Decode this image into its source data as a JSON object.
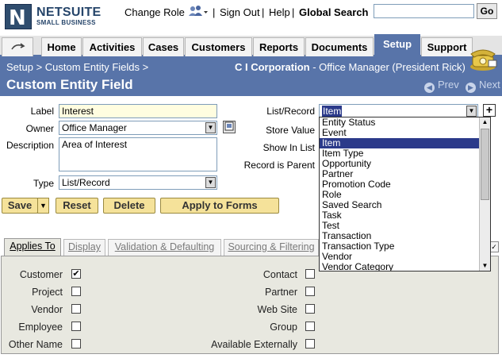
{
  "header": {
    "logo_text": "NETSUITE",
    "logo_sub": "SMALL BUSINESS",
    "change_role": "Change Role",
    "sign_out": "Sign Out",
    "help": "Help",
    "global_search_label": "Global Search",
    "global_search_value": "",
    "go": "Go",
    "sep": "|"
  },
  "tabs": [
    "Home",
    "Activities",
    "Cases",
    "Customers",
    "Reports",
    "Documents",
    "Setup",
    "Support"
  ],
  "breadcrumb": "Setup > Custom Entity Fields >",
  "company": "C I Corporation",
  "role": " - Office Manager (President Rick)",
  "page_title": "Custom Entity Field",
  "nav": {
    "prev": "Prev",
    "next": "Next"
  },
  "form": {
    "label_label": "Label",
    "label_value": "Interest",
    "owner_label": "Owner",
    "owner_value": "Office Manager",
    "description_label": "Description",
    "description_value": "Area of Interest",
    "type_label": "Type",
    "type_value": "List/Record",
    "list_record_label": "List/Record",
    "list_record_value": "Item",
    "store_value_label": "Store Value",
    "show_in_list_label": "Show In List",
    "record_is_parent_label": "Record is Parent"
  },
  "buttons": {
    "save": "Save",
    "reset": "Reset",
    "delete": "Delete",
    "apply": "Apply to Forms"
  },
  "dropdown_options": [
    "Entity Status",
    "Event",
    "Item",
    "Item Type",
    "Opportunity",
    "Partner",
    "Promotion Code",
    "Role",
    "Saved Search",
    "Task",
    "Test",
    "Transaction",
    "Transaction Type",
    "Vendor",
    "Vendor Category"
  ],
  "dropdown_selected": "Item",
  "subtabs": [
    "Applies To",
    "Display",
    "Validation & Defaulting",
    "Sourcing & Filtering"
  ],
  "applies_left": [
    {
      "label": "Customer",
      "checked": true
    },
    {
      "label": "Project",
      "checked": false
    },
    {
      "label": "Vendor",
      "checked": false
    },
    {
      "label": "Employee",
      "checked": false
    },
    {
      "label": "Other Name",
      "checked": false
    }
  ],
  "applies_right": [
    {
      "label": "Contact",
      "checked": false
    },
    {
      "label": "Partner",
      "checked": false
    },
    {
      "label": "Web Site",
      "checked": false
    },
    {
      "label": "Group",
      "checked": false
    },
    {
      "label": "Available Externally",
      "checked": false
    }
  ],
  "colors": {
    "header_blue": "#5874a9",
    "button_yellow": "#f5e29a",
    "field_yellow": "#fffde0",
    "selected_option": "#2b3a8a"
  },
  "icons": [
    "netsuite-logo-icon",
    "role-people-icon",
    "phone-icon",
    "prev-arrow-icon",
    "next-arrow-icon",
    "popup-icon",
    "plus-icon",
    "dropdown-arrow-icon",
    "checkmark-icon"
  ]
}
